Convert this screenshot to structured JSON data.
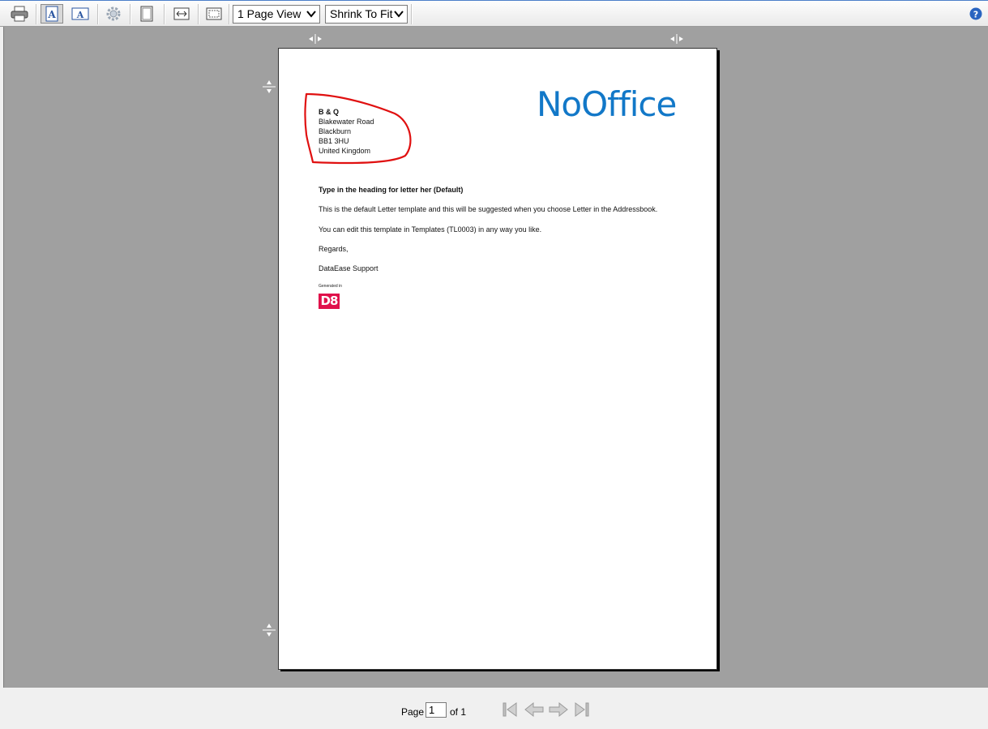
{
  "toolbar": {
    "buttons": [
      {
        "name": "print-button",
        "icon": "printer-icon",
        "tooltip": ""
      },
      {
        "name": "single-page-button",
        "icon": "page-a-icon"
      },
      {
        "name": "page-layout-button",
        "icon": "page-a-small-icon"
      },
      {
        "name": "settings-button",
        "icon": "gear-icon"
      },
      {
        "name": "fit-page-button",
        "icon": "fit-page-icon"
      },
      {
        "name": "fit-width-button",
        "icon": "fit-width-icon"
      },
      {
        "name": "full-screen-button",
        "icon": "full-screen-icon"
      }
    ],
    "view_mode": "1 Page View",
    "zoom_mode": "Shrink To Fit",
    "help_icon": "help-icon"
  },
  "document": {
    "address": {
      "name": "B & Q",
      "line1": "Blakewater Road",
      "line2": "Blackburn",
      "line3": "BB1 3HU",
      "line4": "United Kingdom"
    },
    "logo": "NoOffice",
    "heading": "Type in the heading for letter her (Default)",
    "para1": "This is the default Letter template and this will be suggested when you choose Letter in the Addressbook.",
    "para2": "You can edit this template in Templates (TL0003) in any way you like.",
    "closing": "Regards,",
    "signature": "DataEase Support",
    "badge_caption": "Generated in",
    "badge_text": "D8",
    "annotation_color": "#e01010",
    "brand_color": "#1278c8"
  },
  "footer": {
    "page_label": "Page",
    "page_value": "1",
    "of_label": "of 1",
    "nav": [
      "first-page-icon",
      "prev-page-icon",
      "next-page-icon",
      "last-page-icon"
    ]
  }
}
